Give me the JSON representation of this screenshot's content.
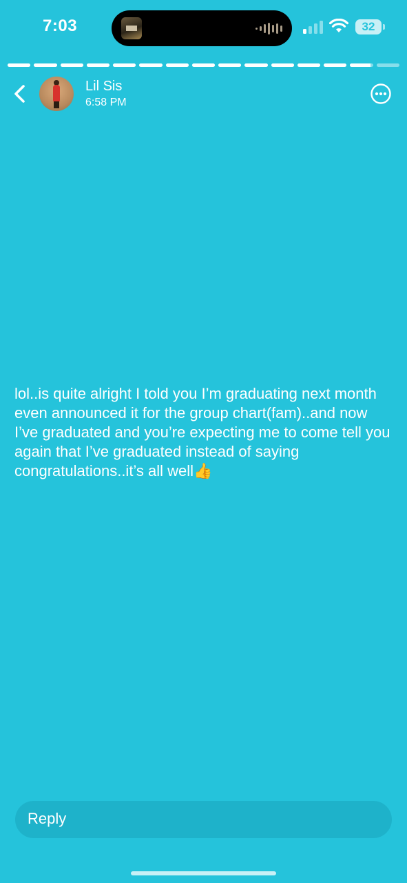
{
  "status_bar": {
    "time": "7:03",
    "battery_level": "32",
    "signal_bars_active": 1,
    "signal_bars_total": 4
  },
  "story": {
    "segments_total": 15,
    "segments_complete": 13,
    "current_segment_progress": 0.9
  },
  "header": {
    "user_name": "Lil Sis",
    "timestamp": "6:58 PM",
    "back_icon": "chevron-left-icon",
    "more_icon": "more-horizontal-circle-icon"
  },
  "message": {
    "text": "lol..is quite alright I told you I’m graduating next month even announced it for the group chart(fam)..and now I’ve graduated and you’re expecting me to come tell you again that I’ve graduated instead of saying congratulations..it’s all well👍"
  },
  "reply": {
    "placeholder": "Reply"
  },
  "colors": {
    "background": "#25C3DB",
    "text": "#FFFFFF"
  }
}
